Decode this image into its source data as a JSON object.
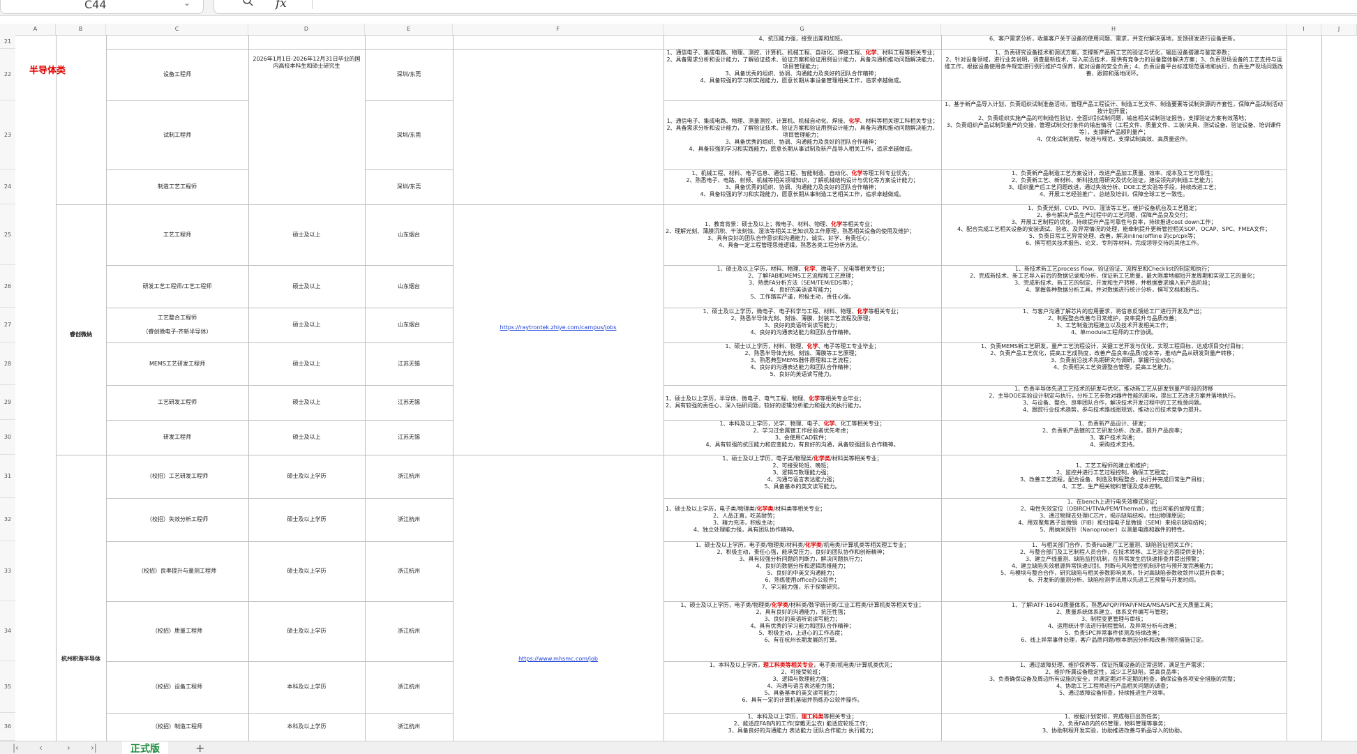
{
  "toolbar": {
    "cell_ref": "C44",
    "fx_label": "fx"
  },
  "columns": [
    "A",
    "B",
    "C",
    "D",
    "E",
    "F",
    "G",
    "H",
    "I",
    "J"
  ],
  "rows": [
    "21",
    "22",
    "23",
    "24",
    "25",
    "26",
    "27",
    "28",
    "29",
    "30",
    "31",
    "32",
    "33",
    "34",
    "35",
    "36"
  ],
  "category": "半导体类",
  "companies": {
    "c1": "睿创微纳",
    "c2": "杭州积海半导体"
  },
  "links": {
    "l1": "https://raytrontek.zhiye.com/campus/jobs",
    "l2": "https://www.mhsmc.com/job"
  },
  "row21": {
    "req": "4、抗压能力强，接受出差和加班。",
    "duty": "6、客户需求分析，收集客户关于设备的使用问题、需求，并支付解决落地，反馈研发进行设备更新。"
  },
  "row22": {
    "pos": "设备工程师",
    "deg": "2026年1月1日-2026年12月31日毕业的国内高校本科生和硕士研究生",
    "loc": "深圳/东莞",
    "req_a": "1、通信电子、集成电路、物理、测控、计算机、机械工程、自动化、焊接工程、",
    "req_b": "化学",
    "req_c": "、材料工程等相关专业；\n2、具备需求分析和设计能力，了解验证技术、验证方案和验证用例设计能力，具备沟通和推动问题解决能力，项目管理能力；\n3、具备优秀的组织、协调、沟通能力及良好的团队合作精神；\n4、具备较强的学习和实践能力，愿意长期从事设备管理相关工作，追求卓越做成。",
    "duty": "1、负责研究设备技术和调试方案，支撑新产品新工艺的验证与优化，输出设备搭建与鉴定参数；\n2、针对设备领域，进行业务说明，调查最新技术，导入前沿技术，提供有竞争力的设备整体解决方案；3、负责现场设备的工艺支持与运维工作，根据设备使用条件规定进行例行维护与保养，能对设备的安全负责；4、负责设备平台标准规范落地和执行，负责生产现场问题改善、跟踪和落地闭环。"
  },
  "row23": {
    "pos": "试制工程师",
    "loc": "深圳/东莞",
    "req_a": "1、通信电子、集成电路、物理、测量测控、计算机、机械自动化、焊接、",
    "req_b": "化学",
    "req_c": "、材料等相关理工科相关专业；\n2、具备需求分析和设计能力，了解验证技术、验证方案和验证用例设计能力，具备沟通和推动问题解决能力，项目管理能力；\n3、具备优秀的组织、协调、沟通能力及良好的团队合作精神；\n4、具备较强的学习和实践能力，愿意长期从事试制及新产品导入相关工作，追求卓越做成。",
    "duty": "1、基于新产品导入计划，负责组织试制准备活动，管理产品工程设计、制造工艺文件、制造要素等试制资源的齐套性，保障产品试制活动按计划开展；\n2、负责组织实施产品的可制造性验证，全面识别试制问题，输出相关试制验证报告，支撑验证方案有效落地；\n3、负责组织产品试制到量产的交接，管理试制交付条件的输出情况（工程文件、质量文件、工装/夹具、测试设备、验证设备、培训课件等），支撑新产品顺利量产；\n4、优化试制流程、标准与规范，支撑试制高效、高质量运作。"
  },
  "row24": {
    "pos": "制造工艺工程师",
    "loc": "深圳/东莞",
    "req_a": "1、机械工程、材料、电子信息、通信工程、智能制造、自动化、",
    "req_b": "化学",
    "req_c": "等理工科专业优先；\n2、熟悉电子、电路、射频、机械等相关领域知识，了解机械结构设计与优化等方案设计能力；\n3、具备优秀的组织、协调、沟通能力及良好的团队合作精神；\n4、具备较强的学习和实践能力，愿意长期从事制造工艺相关工作，追求卓越做成。",
    "duty": "1、负责新产品制造工艺方案设计，改进产品加工质量、效率、成本及工艺可靠性；\n2、负责新工艺、新材料、新科技应用研究及优化验证，建设领先的制造工艺能力；\n3、组织量产后工艺问题改进，通过失效分析、DOE工艺实验等手段，持续改进工艺；\n4、开展工艺经验推广、总结及培训，保障全球工艺一致性。"
  },
  "row25": {
    "pos": "工艺工程师",
    "deg": "硕士及以上",
    "loc": "山东烟台",
    "req_a": "1、教育背景：硕士及以上；微电子、材料、物理、",
    "req_b": "化学",
    "req_c": "等相关专业；\n2、理解光刻、薄膜沉积、干法刻蚀、湿法等相关工艺知识及工作原理，熟悉相关设备的使用及维护；\n3、具有良好的团队合作意识和沟通能力，诚实、好学、有责任心；\n4、具备一定工程管理思维逻辑，熟悉各类工程分析方法。",
    "duty": "1、负责光刻、CVD、PVD、湿法等工艺，维护设备机台及工艺稳定；\n2、参与解决产品生产过程中的工艺问题，保障产品良及交付；\n3、开展工艺制程的优化，持续提升产品可靠性与良率，持续推进cost down工作；\n4、配合完成工艺相关设备的安装调试、验收、及异常情况的处理，能牵制提升更新管控相关SOP、OCAP、SPC、FMEA文件；\n5、负责日常工艺异常处理、改善，解决inline/offline 的cp/cpk等；\n6、撰写相关技术报告、论文、专利等材料，完成领导交待的其他工作。"
  },
  "row26": {
    "pos": "研发工艺工程师/工艺工程师",
    "deg": "硕士及以上",
    "loc": "山东烟台",
    "req_a": "1、硕士及以上学历，材料、物理、",
    "req_b": "化学",
    "req_c": "、微电子、光电等相关专业；\n2、了解FAB和MEMS工艺流程和工艺原理；\n3、熟悉FA分析方法（SEM/TEM/EDS等）；\n4、良好的英语读写能力；\n5、工作踏实严谨，积极主动，责任心强。",
    "duty": "1、新技术新工艺process flow、验证验证、流程单和Checklist的制定和执行；\n2、完成新技术、新工艺导入前后的数据记录和分析，保证新工艺质量，最大限度地缩短开发周期和实现工艺的量化；\n3、完成新技术、新工艺的制定、开发和生产转移，并根据要求编入新产品阶段；\n4、掌握各种数据分析工具，并对数据进行统计分析，撰写文档和报告。"
  },
  "row27": {
    "pos": "工艺整合工程师\n\n（睿创微电子-齐新半导体）",
    "deg": "硕士及以上",
    "loc": "山东烟台",
    "req_a": "1、硕士及以上学历，微电子、电子科学与工程、材料、物理、",
    "req_b": "化学",
    "req_c": "等相关专业；\n2、熟悉半导体光刻、刻蚀、薄膜、封装工艺流程及原理；\n3、良好的英语听说读写能力；\n4、良好的沟通表达能力和团队合作精神。",
    "duty": "1、与客户沟通了解芯片的应用要求，将信息反馈给工厂进行开发及产出；\n2、制程整合改善与日常维护，良率提升与品质改善；\n3、工艺制造流程建立以及技术开发相关工作；\n4、单module工程师的工作协调。"
  },
  "row28": {
    "pos": "MEMS工艺研发工程师",
    "deg": "硕士及以上",
    "loc": "江苏无锡",
    "req_a": "1、硕士以上学历，材料、物理、",
    "req_b": "化学",
    "req_c": "、电子等理工专业毕业；\n2、熟悉半导体光刻、刻蚀、薄膜等工艺原理；\n3、熟悉典型MEMS器件原理和工艺流程；\n4、良好的沟通表达能力和团队合作精神；\n5、良好的英语读写能力。",
    "duty": "1、负责MEMS新工艺研发，量产工艺流程设计，关键工艺开发与优化，实现工程目标，达成项目交付目标；\n2、负责产品工艺优化，提高工艺成熟度，改善产品良率/品质/成本等，推动产品从研发到量产转移；\n3、负责前沿技术先期研究与调研，掌握行业动态；\n4、负责相关工艺资源整合管理，提高工艺能力。"
  },
  "row29": {
    "pos": "工艺研发工程师",
    "deg": "硕士及以上",
    "loc": "江苏无锡",
    "req_a": "1、硕士及以上学历，半导体、微电子、电气工程、物理、",
    "req_b": "化学",
    "req_c": "等相关专业毕业；\n2、具有较强的责任心，深入钻研问题，较好的逻辑分析能力和强大的执行能力。",
    "duty": "1、负责半导体先进工艺技术的研发与优化，推动新工艺从研发到量产阶段的转移\n2、主导DOE实验设计制定与执行，分析工艺参数对器件性能的影响，提出工艺改进方案并落地执行。\n3、与设备、整合、良率团队合作，解决技术开发过程中的工艺瓶颈问题。\n4、跟踪行业技术趋势，参与技术路线图规划，推动公司技术竞争力提升。"
  },
  "row30": {
    "pos": "研发工程师",
    "deg": "硕士及以上",
    "loc": "江苏无锡",
    "req_a": "1、本科及以上学历，光学、物理、电子、",
    "req_b": "化学",
    "req_c": "、化工等相关专业；\n2、学习过金属镀工作经验者优先考虑；\n3、会使用CAD软件；\n4、具有较强的抗压能力和应变能力，有良好的沟通，具备较强团队合作精神。",
    "duty": "1、负责新产品设计、研发；\n2、负责新产品镀的工艺研发分析、改进，提升产品良率；\n3、客户技术沟通；\n4、采购技术支持。"
  },
  "row31": {
    "pos": "（校招）工艺研发工程师",
    "deg": "硕士及以上学历",
    "loc": "浙江杭州",
    "req_a": "1、硕士及以上学历，电子类/物理类/",
    "req_b": "化学类",
    "req_c": "/材料类等相关专业；\n2、可接受轮班、晚班；\n3、逻辑与数理能力强；\n4、沟通与语言表达能力强；\n5、具备基本的英文读写能力。",
    "duty": "1、工艺工程师的建立和维护；\n2、监控并进行工艺过程控制，确保工艺稳定；\n3、改善工艺流程，配合设备、制造及制程整合，执行并完成日常生产目标；\n4、工艺、生产相关物料管理及成本控制。"
  },
  "row32": {
    "pos": "（校招）失效分析工程师",
    "deg": "硕士及以上学历",
    "loc": "浙江杭州",
    "req_a": "1、硕士及以上学历，电子类/物理类/",
    "req_b": "化学类",
    "req_c": "/材料类等相关专业；\n2、人品正直，吃苦耐劳；\n3、精力充沛，积极主动；\n4、独立处理能力强，具有团队协作精神。",
    "duty": "1、在bench上进行电失效模式验证；\n2、电性失效定位（OBIRCH/TIVA/PEM/Thermal），找出可能的故障位置；\n3、通过物理去处理IC芯片，揭示缺陷结构，找出物理原因；\n4、用双聚焦离子显微镜（FIB）和扫描电子显微镜（SEM）来揭示缺陷结构；\n5、用纳米探针（Nanoprober）以测量电路和器件的特性。"
  },
  "row33": {
    "pos": "（校招）良率提升与量测工程师",
    "deg": "硕士及以上学历",
    "loc": "浙江杭州",
    "req_a": "1、硕士及以上学历，电子类/物理类/材料类/",
    "req_b": "化学类",
    "req_c": "/机电类/计算机类等相关理工专业；\n2、积极主动，责任心强，能承受压力，良好的团队协作和创新精神；\n3、具有较强分析问题的判断力，解决问题执行力；\n4、良好的数据分析和逻辑思维能力；\n5、良好的中英文沟通能力；\n6、熟练使用office办公软件；\n7、学习能力强，乐于探索研究。",
    "duty": "1、与相关部门合作，负责Fab建厂工艺量测、缺陷验证相关工作；\n2、与整合部门及工艺制程人员合作，在技术转移、工艺验证方面提供支持；\n3、建立产线量测、缺陷监控机制，在异常发生后快速排查并提出预警；\n4、建立缺陷失效根源异常快速识别、判断与风险管控机制评估与预开发完善能力；\n5、与模块与整合合作，研究缺陷与相关参数影响关系，针对高缺陷参数收敛并以提升良率；\n6、开发新的量测分析、缺陷检测手法用以先进工艺预警与开发时间。"
  },
  "row34": {
    "pos": "（校招）质量工程师",
    "deg": "硕士及以上学历",
    "loc": "浙江杭州",
    "req_a": "1、硕士及以上学历，电子类/物理类/",
    "req_b": "化学类",
    "req_c": "/材料类/数学统计类/工业工程类/计算机类等相关专业；\n2、具有良好的沟通能力，抗压性强；\n3、良好的英语听说读写能力；\n4、具有优秀的学习能力和团队合作精神；\n5、积极主动，上进心的工作态度；\n6、有在杭州长期发展的打算。",
    "duty": "1、了解IATF-16949质量体系，熟悉APQP/PPAP/FMEA/MSA/SPC五大质量工具；\n2、质量系统体系建立、体系文件编写与管理；\n3、制程变更管理与审核；\n4、运用统计手法进行制程管制，及异常分析与改善；\n5、负责SPC异常事件侦测及持续改善；\n6、线上异常事件处理，客户品质问题/根本原因分析和改善/预防措施订定。"
  },
  "row35": {
    "pos": "（校招）设备工程师",
    "deg": "本科及以上学历",
    "loc": "浙江杭州",
    "req_a": "1、本科及以上学历，",
    "req_b": "理工科类等相关专业",
    "req_c": "，电子类/机电类/计算机类优先；\n2、可接受轮班；\n3、逻辑与数理能力强；\n4、沟通与语言表达能力强；\n5、具备基本的英文读写能力；\n6、具有一定的计算机基础并熟练办公软件操作。",
    "duty": "1、通过故障处理、维护保养等，保证所属设备的正常运转，满足生产需求；\n2、维护所属设备稳定性，减少工艺缺陷，提高良品率；\n3、负责确保设备及周边所有设施的安全，并满定期对不定期的检查，确保设备各项安全措施的完整；\n4、协助工艺工程师进行产品相关问题的调查；\n5、通过故障设备排查，持续推进生产效率。"
  },
  "row36": {
    "pos": "（校招）制造工程师",
    "deg": "本科及以上学历",
    "loc": "浙江杭州",
    "req_a": "1、本科及以上学历，",
    "req_b": "理工科类",
    "req_c": "等相关专业；\n2、能适应FAB内的工作(穿戴无尘衣) 能适应轮班工作；\n3、具备良好的沟通能力 表达能力 团队合作能力 执行能力；",
    "duty": "1、根据计划安排，完成每日出货任务；\n2、负责FAB内的6S管理，物料管理等事务；\n3、协助制程开发实验，协助推进改善与新品导入的协助。"
  },
  "sheet_tab": "正式版"
}
